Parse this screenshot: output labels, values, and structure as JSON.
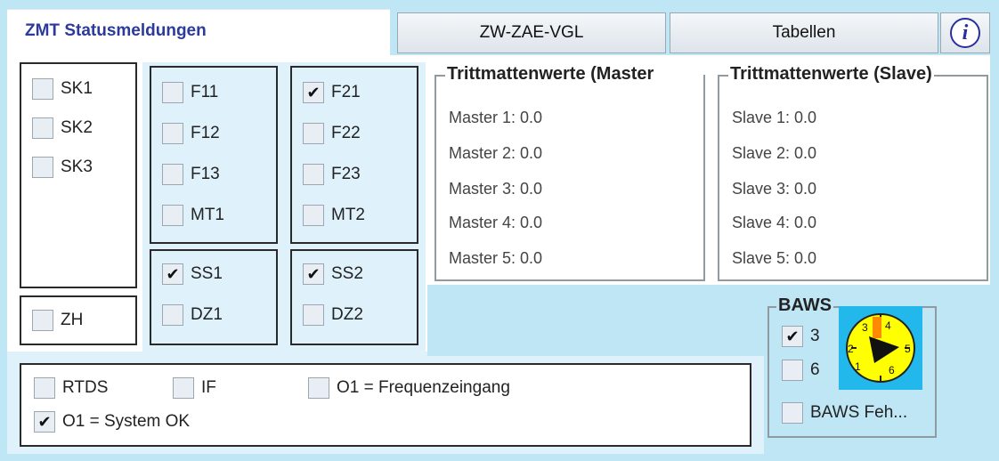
{
  "header": {
    "title": "ZMT Statusmeldungen",
    "button_zw": "ZW-ZAE-VGL",
    "button_tabellen": "Tabellen",
    "info_symbol": "i"
  },
  "sk_group": {
    "items": [
      {
        "label": "SK1",
        "checked": false
      },
      {
        "label": "SK2",
        "checked": false
      },
      {
        "label": "SK3",
        "checked": false
      }
    ]
  },
  "zh": {
    "label": "ZH",
    "checked": false
  },
  "f1_group": {
    "items": [
      {
        "label": "F11",
        "checked": false
      },
      {
        "label": "F12",
        "checked": false
      },
      {
        "label": "F13",
        "checked": false
      },
      {
        "label": "MT1",
        "checked": false
      }
    ]
  },
  "f2_group": {
    "items": [
      {
        "label": "F21",
        "checked": true
      },
      {
        "label": "F22",
        "checked": false
      },
      {
        "label": "F23",
        "checked": false
      },
      {
        "label": "MT2",
        "checked": false
      }
    ]
  },
  "ss1_group": {
    "items": [
      {
        "label": "SS1",
        "checked": true
      },
      {
        "label": "DZ1",
        "checked": false
      }
    ]
  },
  "ss2_group": {
    "items": [
      {
        "label": "SS2",
        "checked": true
      },
      {
        "label": "DZ2",
        "checked": false
      }
    ]
  },
  "master": {
    "title": "Trittmattenwerte (Master",
    "values": [
      "Master 1: 0.0",
      "Master 2: 0.0",
      "Master 3: 0.0",
      "Master 4: 0.0",
      "Master 5: 0.0"
    ]
  },
  "slave": {
    "title": "Trittmattenwerte (Slave)",
    "values": [
      "Slave 1: 0.0",
      "Slave 2: 0.0",
      "Slave 3: 0.0",
      "Slave 4: 0.0",
      "Slave 5: 0.0"
    ]
  },
  "bottom": {
    "rtds": {
      "label": "RTDS",
      "checked": false
    },
    "if": {
      "label": "IF",
      "checked": false
    },
    "o1_freq": {
      "label": "O1 = Frequenzeingang",
      "checked": false
    },
    "o1_system": {
      "label": "O1 = System OK",
      "checked": true
    }
  },
  "baws": {
    "title": "BAWS",
    "opt3": {
      "label": "3",
      "checked": true
    },
    "opt6": {
      "label": "6",
      "checked": false
    },
    "fehler": {
      "label": "BAWS Feh...",
      "checked": false
    },
    "dial_numbers": [
      "1",
      "2",
      "3",
      "4",
      "5",
      "6"
    ]
  },
  "colors": {
    "background": "#bfe6f5",
    "title_color": "#2b3a9b",
    "dial_yellow": "#ffff00",
    "dial_background": "#22b8ec",
    "dial_pointer": "#ff8a00"
  },
  "icons": {
    "check": "✔",
    "info": "info-icon",
    "dial": "baws-dial-icon"
  }
}
